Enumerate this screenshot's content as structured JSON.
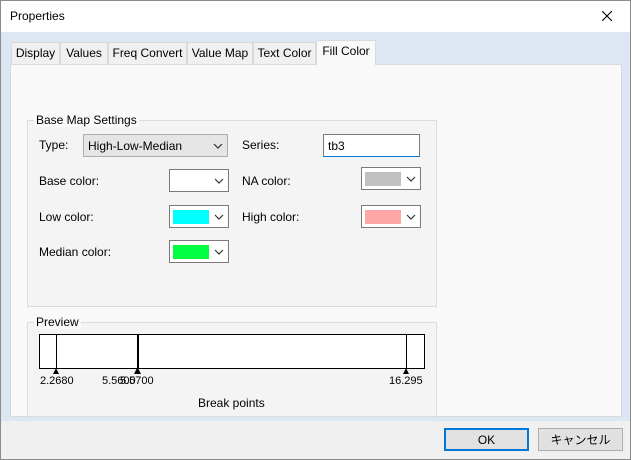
{
  "window": {
    "title": "Properties"
  },
  "tabs": [
    {
      "label": "Display",
      "active": false
    },
    {
      "label": "Values",
      "active": false
    },
    {
      "label": "Freq Convert",
      "active": false
    },
    {
      "label": "Value Map",
      "active": false
    },
    {
      "label": "Text Color",
      "active": false
    },
    {
      "label": "Fill Color",
      "active": true
    }
  ],
  "base_map": {
    "title": "Base Map Settings",
    "type_label": "Type:",
    "type_value": "High-Low-Median",
    "series_label": "Series:",
    "series_value": "tb3",
    "base_color_label": "Base color:",
    "na_color_label": "NA color:",
    "low_color_label": "Low color:",
    "high_color_label": "High color:",
    "median_color_label": "Median color:",
    "colors": {
      "base": "#ffffff",
      "na": "#c0c0c0",
      "low": "#00ffff",
      "high": "#ffa6a6",
      "median": "#00ff40"
    }
  },
  "preview": {
    "title": "Preview",
    "caption": "Break points",
    "break_labels": [
      "2.2680",
      "5.5600",
      "5.5700",
      "16.295"
    ],
    "break_values": [
      2.268,
      5.56,
      5.57,
      16.295
    ]
  },
  "buttons": {
    "ok": "OK",
    "cancel": "キャンセル"
  }
}
